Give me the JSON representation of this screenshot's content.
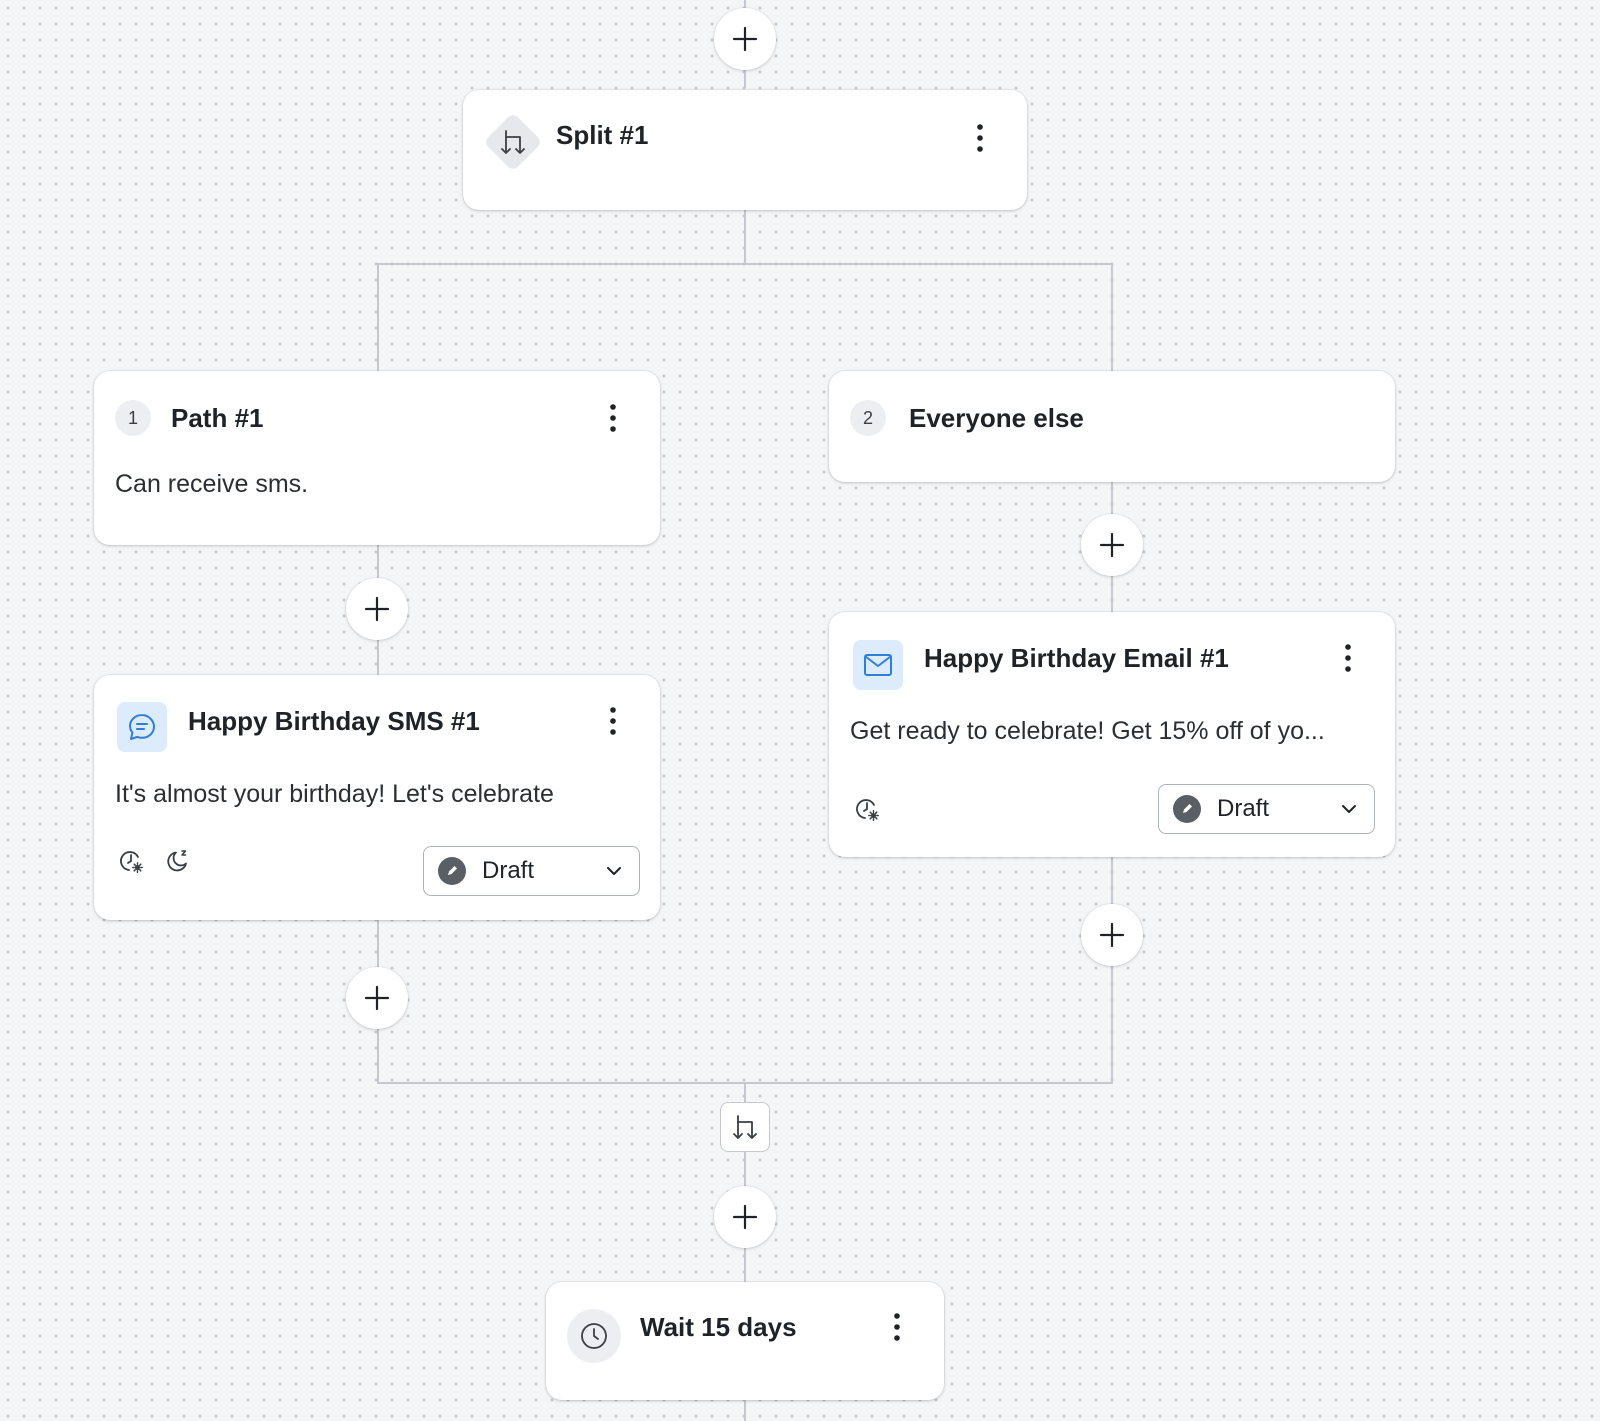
{
  "split": {
    "title": "Split #1"
  },
  "paths": [
    {
      "number": "1",
      "title": "Path #1",
      "condition": "Can receive sms."
    },
    {
      "number": "2",
      "title": "Everyone else"
    }
  ],
  "sms": {
    "title": "Happy Birthday SMS #1",
    "preview": "It's almost your birthday! Let's celebrate",
    "status": "Draft"
  },
  "email": {
    "title": "Happy Birthday Email #1",
    "preview": "Get ready to celebrate! Get 15% off of yo...",
    "status": "Draft"
  },
  "wait": {
    "title": "Wait 15 days"
  },
  "colors": {
    "canvas_bg": "#f4f5f7",
    "connector": "#c5c9cf",
    "channel_icon_bg": "#dcecfd",
    "channel_icon_fg": "#2f7fd8",
    "status_dot": "#5a5f66"
  }
}
